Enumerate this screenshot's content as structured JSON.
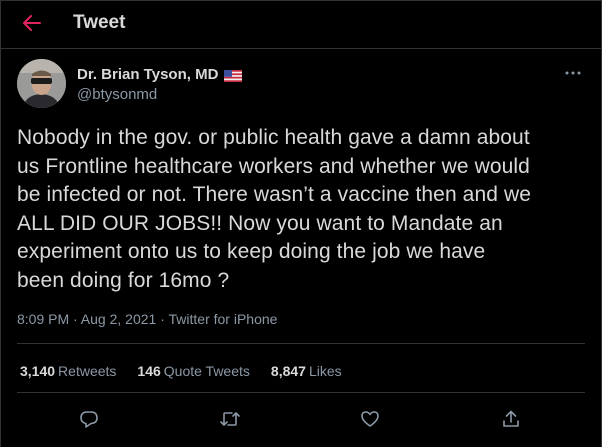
{
  "header": {
    "title": "Tweet",
    "back_icon": "arrow-left-icon"
  },
  "author": {
    "display_name": "Dr. Brian Tyson, MD",
    "handle": "@btysonmd",
    "badge_icon": "us-flag-emoji"
  },
  "tweet": {
    "text": "Nobody in the gov. or public health gave a damn about\nus Frontline healthcare workers and whether we would\nbe infected or not.  There wasn’t a vaccine then and we\nALL DID OUR JOBS!! Now you want to Mandate an\nexperiment onto us to keep doing the job we have\nbeen doing for 16mo ?",
    "meta": "8:09 PM · Aug 2, 2021 · Twitter for iPhone"
  },
  "stats": {
    "retweets": {
      "count": "3,140",
      "label": "Retweets"
    },
    "quotes": {
      "count": "146",
      "label": "Quote Tweets"
    },
    "likes": {
      "count": "8,847",
      "label": "Likes"
    }
  },
  "actions": [
    "reply-icon",
    "retweet-icon",
    "like-icon",
    "share-icon"
  ],
  "colors": {
    "background": "#000000",
    "text": "#d9d9d9",
    "secondary": "#8b98a5",
    "accent": "#e0245e",
    "border": "#2f3336"
  }
}
